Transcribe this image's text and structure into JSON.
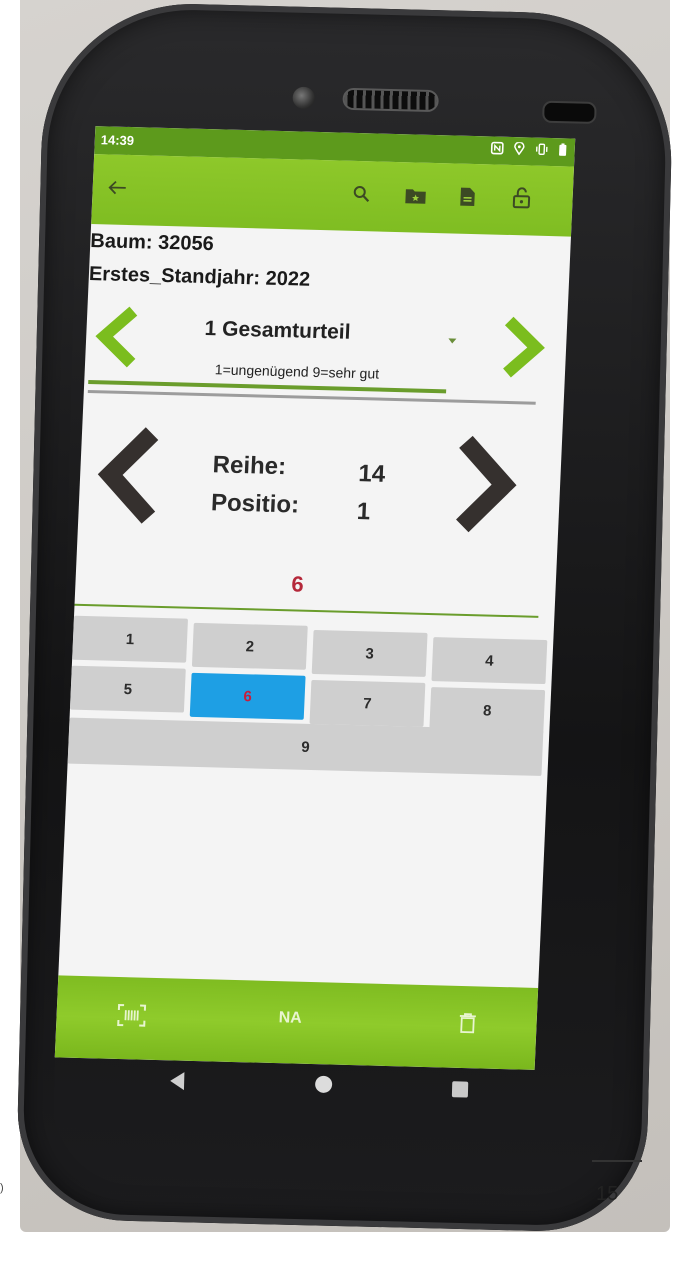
{
  "status": {
    "time": "14:39",
    "icons": [
      "nfc-icon",
      "location-icon",
      "vibrate-icon",
      "battery-icon"
    ]
  },
  "toolbar": {
    "back_icon": "arrow-left-icon",
    "icons": [
      "search-icon",
      "folder-star-icon",
      "document-icon",
      "unlock-icon"
    ]
  },
  "record": {
    "baum_line": "Baum: 32056",
    "standjahr_line": "Erstes_Standjahr: 2022"
  },
  "selector": {
    "title": "1 Gesamturteil",
    "hint": "1=ungenügend  9=sehr gut"
  },
  "position": {
    "reihe_label": "Reihe:",
    "reihe_value": "14",
    "position_label": "Positio:",
    "position_value": "1"
  },
  "selected_value": "6",
  "keypad": {
    "keys": [
      "1",
      "2",
      "3",
      "4",
      "5",
      "6",
      "7",
      "8",
      "9"
    ],
    "active": "6"
  },
  "bottombar": {
    "barcode_icon": "barcode-scan-icon",
    "na_label": "NA",
    "delete_icon": "trash-icon"
  },
  "slide": {
    "page_number": "15",
    "left_fragment": ")"
  },
  "colors": {
    "toolbar_green": "#8ec82a",
    "status_green": "#5d9a1c",
    "active_key": "#1e9fe4",
    "selected_text": "#b5283a"
  }
}
